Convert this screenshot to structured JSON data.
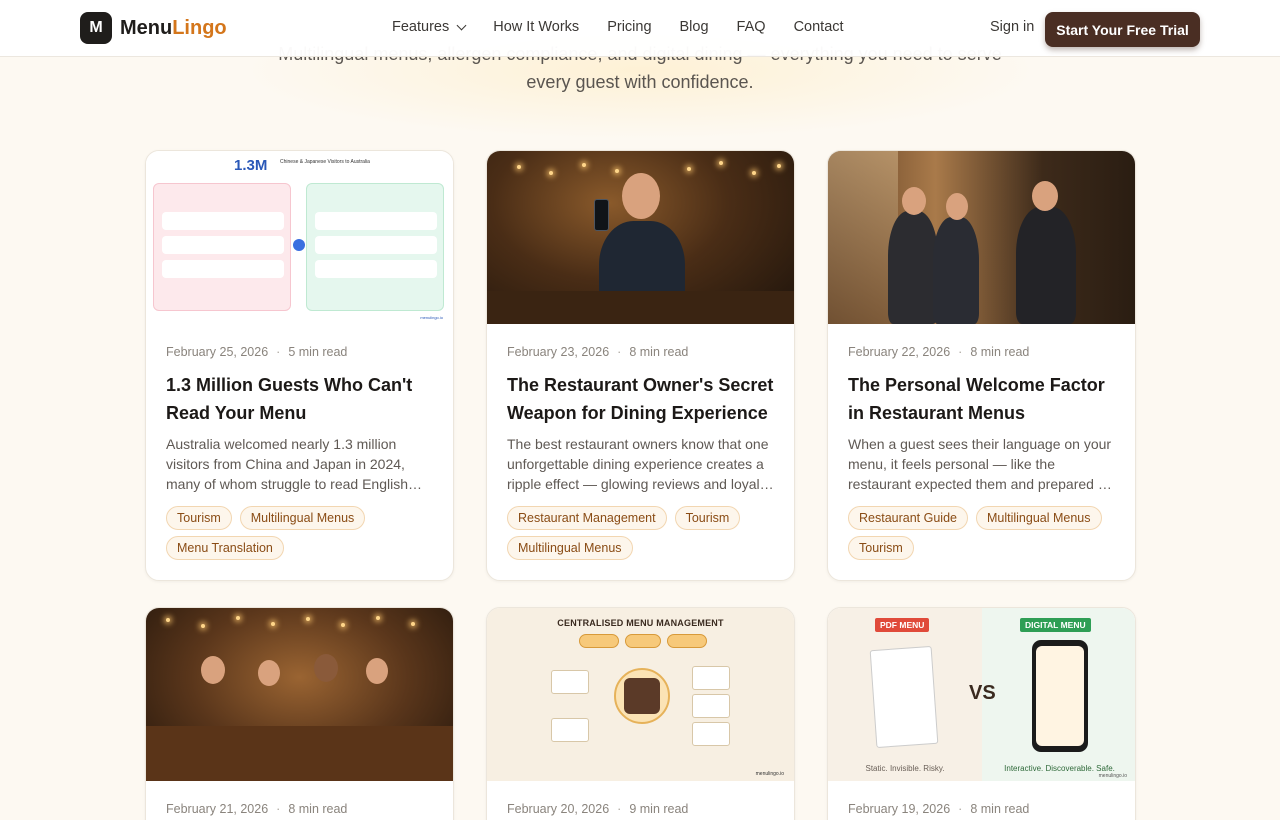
{
  "header": {
    "logo_mark": "M",
    "logo_text_main": "Menu",
    "logo_text_accent": "Lingo",
    "nav": [
      {
        "label": "Features"
      },
      {
        "label": "How It Works"
      },
      {
        "label": "Pricing"
      },
      {
        "label": "Blog"
      },
      {
        "label": "FAQ"
      },
      {
        "label": "Contact"
      }
    ],
    "signin": "Sign in",
    "cta": "Start Your Free Trial"
  },
  "hero": {
    "subtitle_line1": "Multilingual menus, allergen compliance, and digital dining — everything you need to serve",
    "subtitle_line2": "every guest with confidence."
  },
  "colors": {
    "accent": "#d4761b",
    "cta_bg": "#4a2e23",
    "tag_text": "#8a4c15",
    "tag_border": "#f2d6b1"
  },
  "posts": [
    {
      "date": "February 25, 2026",
      "read": "5 min read",
      "title": "1.3 Million Guests Who Can't Read Your Menu",
      "excerpt": "Australia welcomed nearly 1.3 million visitors from China and Japan in 2024, many of whom struggle to read English menus.",
      "tags": [
        "Tourism",
        "Multilingual Menus",
        "Menu Translation"
      ],
      "image_text": {
        "big": "1.3M",
        "caption": "Chinese & Japanese Visitors to Australia",
        "footer_right": "menulingo.io"
      }
    },
    {
      "date": "February 23, 2026",
      "read": "8 min read",
      "title": "The Restaurant Owner's Secret Weapon for Dining Experience",
      "excerpt": "The best restaurant owners know that one unforgettable dining experience creates a ripple effect — glowing reviews and loyal guests.",
      "tags": [
        "Restaurant Management",
        "Tourism",
        "Multilingual Menus"
      ]
    },
    {
      "date": "February 22, 2026",
      "read": "8 min read",
      "title": "The Personal Welcome Factor in Restaurant Menus",
      "excerpt": "When a guest sees their language on your menu, it feels personal — like the restaurant expected them and prepared for their visit.",
      "tags": [
        "Restaurant Guide",
        "Multilingual Menus",
        "Tourism"
      ]
    },
    {
      "date": "February 21, 2026",
      "read": "8 min read"
    },
    {
      "date": "February 20, 2026",
      "read": "9 min read",
      "image_text": {
        "title": "CENTRALISED MENU MANAGEMENT",
        "footer_right": "menulingo.io"
      }
    },
    {
      "date": "February 19, 2026",
      "read": "8 min read",
      "image_text": {
        "left_label": "PDF MENU",
        "right_label": "DIGITAL MENU",
        "vs": "VS",
        "left_foot": "Static. Invisible. Risky.",
        "right_foot": "Interactive. Discoverable. Safe.",
        "footer_right": "menulingo.io"
      }
    }
  ]
}
